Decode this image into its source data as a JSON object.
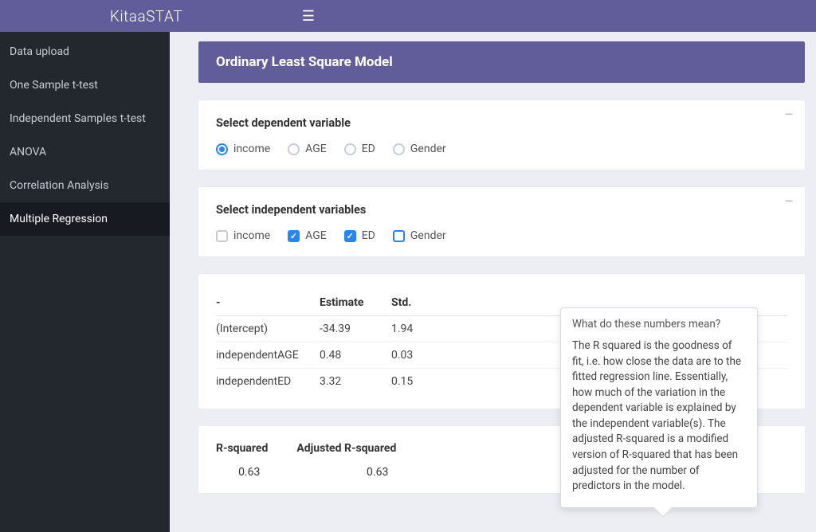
{
  "brand": "KitaaSTAT",
  "sidebar": {
    "items": [
      {
        "label": "Data upload"
      },
      {
        "label": "One Sample t-test"
      },
      {
        "label": "Independent Samples t-test"
      },
      {
        "label": "ANOVA"
      },
      {
        "label": "Correlation Analysis"
      },
      {
        "label": "Multiple Regression"
      }
    ],
    "active_index": 5
  },
  "page_title": "Ordinary Least Square Model",
  "dependent": {
    "heading": "Select dependent variable",
    "options": [
      {
        "label": "income",
        "selected": true
      },
      {
        "label": "AGE",
        "selected": false
      },
      {
        "label": "ED",
        "selected": false
      },
      {
        "label": "Gender",
        "selected": false
      }
    ]
  },
  "independent": {
    "heading": "Select independent variables",
    "options": [
      {
        "label": "income",
        "checked": false
      },
      {
        "label": "AGE",
        "checked": true
      },
      {
        "label": "ED",
        "checked": true
      },
      {
        "label": "Gender",
        "checked": false
      }
    ]
  },
  "coeff_table": {
    "headers": [
      "-",
      "Estimate",
      "Std."
    ],
    "rows": [
      {
        "term": "(Intercept)",
        "estimate": "-34.39",
        "std": "1.94"
      },
      {
        "term": "independentAGE",
        "estimate": "0.48",
        "std": "0.03"
      },
      {
        "term": "independentED",
        "estimate": "3.32",
        "std": "0.15"
      }
    ]
  },
  "rsq": {
    "r_label": "R-squared",
    "adj_label": "Adjusted R-squared",
    "r_value": "0.63",
    "adj_value": "0.63"
  },
  "popover": {
    "title": "What do these numbers mean?",
    "body": "The R squared is the goodness of fit, i.e. how close the data are to the fitted regression line. Essentially, how much of the variation in the dependent variable is explained by the independent variable(s). The adjusted R-squared is a modified version of R-squared that has been adjusted for the number of predictors in the model."
  }
}
